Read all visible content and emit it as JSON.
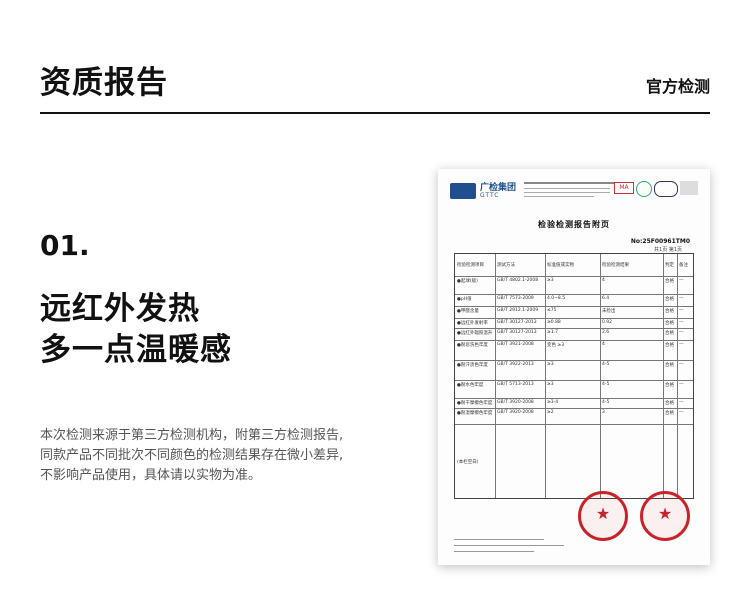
{
  "header": {
    "title": "资质报告",
    "right": "官方检测"
  },
  "section": {
    "number": "01.",
    "headline_1": "远红外发热",
    "headline_2": "多一点温暖感",
    "description": [
      "本次检测来源于第三方检测机构，附第三方检测报告,",
      "同款产品不同批次不同颜色的检测结果存在微小差异,",
      "不影响产品使用，具体请以实物为准。"
    ]
  },
  "report": {
    "logo_text": "广检集团",
    "logo_sub": "GTTC",
    "cert_ma": "MA",
    "title": "检验检测报告附页",
    "report_no": "No:25F00961TM0",
    "page_no": "共1页 第1页",
    "columns": [
      "检验检测项目",
      "测试方法",
      "标准值或实物",
      "检验检测结果",
      "判定",
      "备注"
    ],
    "rows": [
      {
        "item": "●起球(级)",
        "method": "GB/T 4802.1-2008",
        "std": "≥3",
        "result": "4",
        "judge": "合格",
        "note": "—"
      },
      {
        "item": "●pH值",
        "method": "GB/T 7573-2009",
        "std": "4.0~8.5",
        "result": "6.4",
        "judge": "合格",
        "note": "—"
      },
      {
        "item": "●甲醛含量",
        "method": "GB/T 2912.1-2009",
        "std": "≤75",
        "result": "未检出",
        "judge": "合格",
        "note": "—"
      },
      {
        "item": "●远红外发射率",
        "method": "GB/T 30127-2013",
        "std": "≥0.88",
        "result": "0.92",
        "judge": "合格",
        "note": "—"
      },
      {
        "item": "●远红外辐照温升",
        "method": "GB/T 30127-2013",
        "std": "≥1.7",
        "result": "2.6",
        "judge": "合格",
        "note": "—"
      },
      {
        "item": "●耐皂洗色牢度",
        "method": "GB/T 3921-2008",
        "std": "变色 ≥3",
        "result": "4",
        "judge": "合格",
        "note": "—"
      },
      {
        "item": "●耐汗渍色牢度",
        "method": "GB/T 3922-2013",
        "std": "≥3",
        "result": "4-5",
        "judge": "合格",
        "note": "—"
      },
      {
        "item": "●耐水色牢度",
        "method": "GB/T 5713-2013",
        "std": "≥3",
        "result": "4-5",
        "judge": "合格",
        "note": "—"
      },
      {
        "item": "●耐干摩擦色牢度",
        "method": "GB/T 3920-2008",
        "std": "≥3-4",
        "result": "4-5",
        "judge": "合格",
        "note": "—"
      },
      {
        "item": "●耐湿摩擦色牢度",
        "method": "GB/T 3920-2008",
        "std": "≥2",
        "result": "3",
        "judge": "合格",
        "note": "—"
      }
    ],
    "remark_label": "(本栏空白)"
  },
  "colors": {
    "accent": "#111111",
    "stamp": "#c8222a",
    "logo": "#1f4f8f"
  }
}
